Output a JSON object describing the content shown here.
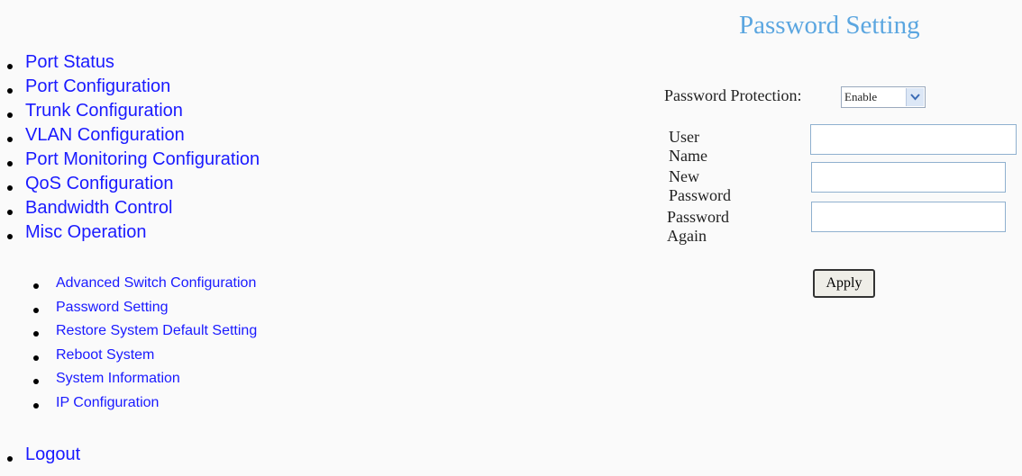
{
  "header": {
    "title": "Password Setting"
  },
  "menu": {
    "items": [
      {
        "label": "Port Status"
      },
      {
        "label": "Port Configuration"
      },
      {
        "label": "Trunk Configuration"
      },
      {
        "label": "VLAN Configuration"
      },
      {
        "label": "Port Monitoring Configuration"
      },
      {
        "label": "QoS Configuration"
      },
      {
        "label": "Bandwidth Control"
      },
      {
        "label": "Misc Operation"
      }
    ],
    "submenu": [
      {
        "label": "Advanced Switch Configuration"
      },
      {
        "label": "Password Setting"
      },
      {
        "label": "Restore System Default Setting"
      },
      {
        "label": "Reboot System"
      },
      {
        "label": "System Information"
      },
      {
        "label": "IP Configuration"
      }
    ],
    "logout": "Logout"
  },
  "form": {
    "protection_label": "Password Protection:",
    "protection_value": "Enable",
    "user_name_label": "User Name",
    "user_name_value": "",
    "new_password_label": "New Password",
    "new_password_value": "",
    "password_again_label": "Password Again",
    "password_again_value": "",
    "apply_label": "Apply"
  },
  "colors": {
    "title": "#5ba6e0",
    "link": "#1a1aff"
  }
}
